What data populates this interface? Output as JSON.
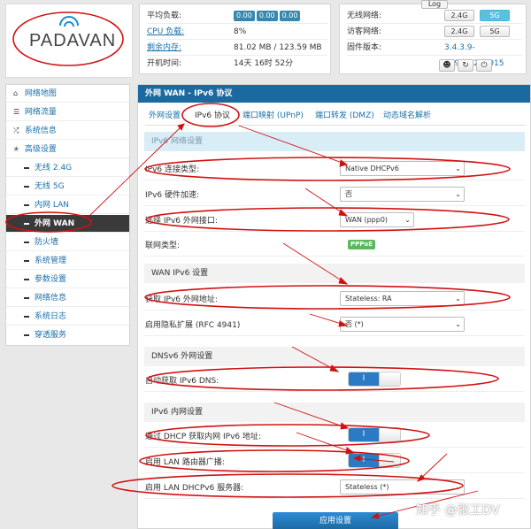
{
  "logo": {
    "text": "PADAVAN"
  },
  "status": {
    "rows": [
      {
        "label": "平均负载:",
        "badges": [
          "0.00",
          "0.00",
          "0.00"
        ]
      },
      {
        "label": "CPU 负载:",
        "value": "8%"
      },
      {
        "label": "剩余内存:",
        "value": "81.02 MB / 123.59 MB"
      },
      {
        "label": "开机时间:",
        "value": "14天 16时 52分"
      }
    ]
  },
  "net": {
    "log_button": "Log",
    "wireless_label": "无线网络:",
    "guest_label": "访客网络:",
    "firmware_label": "固件版本:",
    "band_24": "2.4G",
    "band_5": "5G",
    "firmware_version": "3.4.3.9-099_20201015",
    "icons": [
      "user-icon",
      "refresh-icon",
      "power-icon"
    ]
  },
  "sidebar": {
    "items": [
      {
        "label": "网络地图",
        "icon": "home-icon"
      },
      {
        "label": "网络流量",
        "icon": "list-icon"
      },
      {
        "label": "系统信息",
        "icon": "shuffle-icon"
      },
      {
        "label": "高级设置",
        "icon": "wrench-icon"
      },
      {
        "label": "无线 2.4G"
      },
      {
        "label": "无线 5G"
      },
      {
        "label": "内网 LAN"
      },
      {
        "label": "外网 WAN"
      },
      {
        "label": "防火墙"
      },
      {
        "label": "系统管理"
      },
      {
        "label": "参数设置"
      },
      {
        "label": "网络信息"
      },
      {
        "label": "系统日志"
      },
      {
        "label": "穿透服务"
      }
    ]
  },
  "main": {
    "header": "外网 WAN - IPv6 协议",
    "tabs": [
      "外网设置",
      "IPv6 协议",
      "端口映射 (UPnP)",
      "端口转发 (DMZ)",
      "动态域名解析"
    ],
    "sections": {
      "s1": "IPv6 网络设置",
      "s2": "WAN IPv6 设置",
      "s3": "DNSv6 外网设置",
      "s4": "IPv6 内网设置"
    },
    "fields": {
      "conn_type": {
        "label": "IPv6 连接类型:",
        "value": "Native DHCPv6"
      },
      "hw_accel": {
        "label": "IPv6 硬件加速:",
        "value": "否"
      },
      "wan_iface": {
        "label": "选择 IPv6 外网接口:",
        "value": "WAN (ppp0)"
      },
      "link_type": {
        "label": "联网类型:",
        "value": "PPPoE"
      },
      "wan_addr": {
        "label": "获取 IPv6 外网地址:",
        "value": "Stateless: RA"
      },
      "privacy": {
        "label": "启用隐私扩展 (RFC 4941)",
        "value": "否 (*)"
      },
      "auto_dns": {
        "label": "自动获取 IPv6 DNS:",
        "toggle": "I"
      },
      "dhcp_lan": {
        "label": "通过 DHCP 获取内网 IPv6 地址:",
        "toggle": "I"
      },
      "lan_ra": {
        "label": "启用 LAN 路由器广播:",
        "toggle": "I"
      },
      "dhcpv6_server": {
        "label": "启用 LAN DHCPv6 服务器:",
        "value": "Stateless (*)"
      }
    },
    "apply": "应用设置"
  },
  "watermark": "知乎 @张工DV",
  "colors": {
    "header_blue": "#1a6aa0",
    "annotation_red": "#d11111",
    "toggle_blue": "#2b7bc4",
    "pppoe_green": "#5cb85c"
  }
}
